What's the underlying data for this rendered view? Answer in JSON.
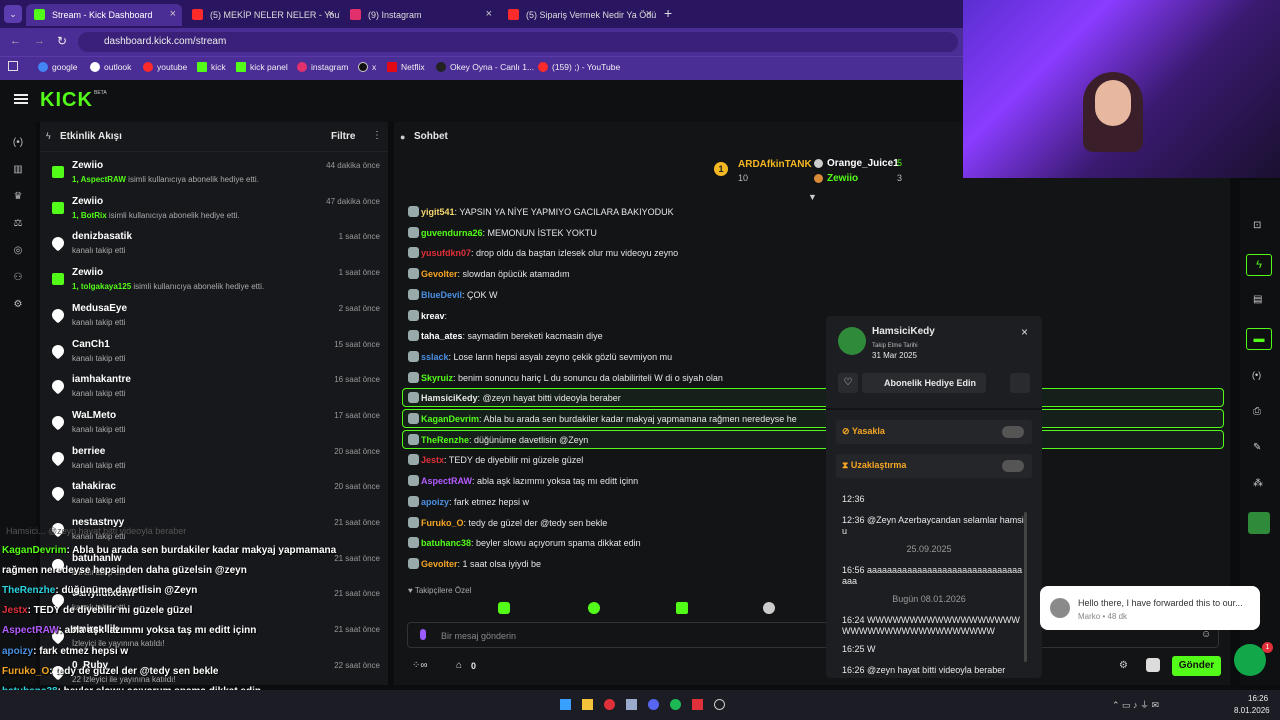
{
  "browser": {
    "tabs": [
      {
        "label": "Stream - Kick Dashboard",
        "color": "#53fc18"
      },
      {
        "label": "(5) MEKİP NELER NELER - YouTu",
        "color": "#ff2a2a"
      },
      {
        "label": "(9) Instagram",
        "color": "#e1306c"
      },
      {
        "label": "(5) Sipariş Vermek Nedir Ya Ödü",
        "color": "#ff2a2a"
      }
    ],
    "url": "dashboard.kick.com/stream",
    "bookmarks": [
      "google",
      "outlook",
      "youtube",
      "kick",
      "kick panel",
      "instagram",
      "x",
      "Netflix",
      "Okey Oyna - Canlı 1...",
      "(159) ;) - YouTube"
    ]
  },
  "kick": {
    "logo": "KICK",
    "beta": "BETA"
  },
  "activity": {
    "title": "Etkinlik Akışı",
    "filter": "Filtre",
    "items": [
      {
        "name": "Zewiio",
        "sub_b": "1, AspectRAW",
        "sub": " isimli kullanıcıya abonelik hediye etti.",
        "time": "44 dakika önce",
        "kind": "gift"
      },
      {
        "name": "Zewiio",
        "sub_b": "1, BotRix",
        "sub": " isimli kullanıcıya abonelik hediye etti.",
        "time": "47 dakika önce",
        "kind": "gift"
      },
      {
        "name": "denizbasatik",
        "sub_b": "",
        "sub": "kanalı takip etti",
        "time": "1 saat önce",
        "kind": "follow"
      },
      {
        "name": "Zewiio",
        "sub_b": "1, tolgakaya125",
        "sub": " isimli kullanıcıya abonelik hediye etti.",
        "time": "1 saat önce",
        "kind": "gift"
      },
      {
        "name": "MedusaEye",
        "sub_b": "",
        "sub": "kanalı takip etti",
        "time": "2 saat önce",
        "kind": "follow"
      },
      {
        "name": "CanCh1",
        "sub_b": "",
        "sub": "kanalı takip etti",
        "time": "15 saat önce",
        "kind": "follow"
      },
      {
        "name": "iamhakantre",
        "sub_b": "",
        "sub": "kanalı takip etti",
        "time": "16 saat önce",
        "kind": "follow"
      },
      {
        "name": "WaLMeto",
        "sub_b": "",
        "sub": "kanalı takip etti",
        "time": "17 saat önce",
        "kind": "follow"
      },
      {
        "name": "berriee",
        "sub_b": "",
        "sub": "kanalı takip etti",
        "time": "20 saat önce",
        "kind": "follow"
      },
      {
        "name": "tahakirac",
        "sub_b": "",
        "sub": "kanalı takip etti",
        "time": "20 saat önce",
        "kind": "follow"
      },
      {
        "name": "nestastnyy",
        "sub_b": "",
        "sub": "kanalı takip etti",
        "time": "21 saat önce",
        "kind": "follow"
      },
      {
        "name": "batuhanlw",
        "sub_b": "",
        "sub": "kanalı takip etti",
        "time": "21 saat önce",
        "kind": "follow"
      },
      {
        "name": "dariyildixonn",
        "sub_b": "",
        "sub": "kanalı takip etti",
        "time": "21 saat önce",
        "kind": "follow"
      },
      {
        "name": "emirsellik",
        "sub_b": "",
        "sub": "İzleyici ile yayınına katıldı!",
        "time": "21 saat önce",
        "kind": "follow"
      },
      {
        "name": "0_Ruby",
        "sub_b": "",
        "sub": "22 İzleyici ile yayınına katıldı!",
        "time": "22 saat önce",
        "kind": "follow"
      }
    ]
  },
  "chat": {
    "title": "Sohbet",
    "top": [
      {
        "name": "ARDAfkinTANK",
        "val": "10"
      },
      {
        "name": "Orange_Juice1",
        "val": "5"
      },
      {
        "name": "Zewiio",
        "val": "3"
      }
    ],
    "messages": [
      {
        "user": "yigit541",
        "color": "#f5d76e",
        "text": ": YAPSIN YA NİYE YAPMIYO GACILARA BAKIYODUK",
        "hl": false
      },
      {
        "user": "guvendurna26",
        "color": "#53fc18",
        "text": ": MEMONUN İSTEK YOKTU",
        "hl": false
      },
      {
        "user": "yusufdkn07",
        "color": "#e0303a",
        "text": ": drop oldu da baştan izlesek olur mu videoyu zeyno",
        "hl": false
      },
      {
        "user": "Gevolter",
        "color": "#f5a623",
        "text": ": slowdan öpücük atamadım",
        "hl": false
      },
      {
        "user": "BlueDevil",
        "color": "#4a90e2",
        "text": ": ÇOK W",
        "hl": false
      },
      {
        "user": "kreav",
        "color": "#ffffff",
        "text": ":",
        "hl": false
      },
      {
        "user": "taha_ates",
        "color": "#ffffff",
        "text": ": saymadim bereketi kacmasin diye",
        "hl": false
      },
      {
        "user": "sslack",
        "color": "#4a90e2",
        "text": ": Lose ların hepsi asyalı zeyno çekik gözlü sevmiyon mu",
        "hl": false
      },
      {
        "user": "Skyruiz",
        "color": "#53fc18",
        "text": ": benim sonuncu hariç L du sonuncu da olabiliriteli W di o siyah olan",
        "hl": false
      },
      {
        "user": "HamsiciKedy",
        "color": "#e6e6e6",
        "text": ": @zeyn hayat bitti videoyla beraber",
        "hl": true
      },
      {
        "user": "KaganDevrim",
        "color": "#53fc18",
        "text": ": Abla bu arada sen burdakiler kadar makyaj yapmamana rağmen neredeyse he",
        "hl": true
      },
      {
        "user": "TheRenzhe",
        "color": "#53fc18",
        "text": ": düğünüme davetlisin @Zeyn",
        "hl": true
      },
      {
        "user": "Jestx",
        "color": "#e0303a",
        "text": ": TEDY de diyebilir mi güzele güzel",
        "hl": false
      },
      {
        "user": "AspectRAW",
        "color": "#b45cff",
        "text": ": abla aşk lazımmı yoksa taş mı editt içinn",
        "hl": false
      },
      {
        "user": "apoizy",
        "color": "#4a90e2",
        "text": ": fark etmez hepsi w",
        "hl": false
      },
      {
        "user": "Furuko_O",
        "color": "#f5a623",
        "text": ": tedy de güzel der @tedy sen bekle",
        "hl": false
      },
      {
        "user": "batuhanc38",
        "color": "#53fc18",
        "text": ": beyler slowu açıyorum spama dikkat edin",
        "hl": false
      },
      {
        "user": "Gevolter",
        "color": "#f5a623",
        "text": ": 1 saat olsa iyiydi be",
        "hl": false
      }
    ],
    "followers_only": "Takipçilere Özel",
    "input_placeholder": "Bir mesaj gönderin",
    "points": "0",
    "send": "Gönder"
  },
  "popup": {
    "user": "HamsiciKedy",
    "follow_label": "Takip Etme Tarihi",
    "follow_date": "31 Mar 2025",
    "gift": "Abonelik Hediye Edin",
    "ban": "Yasakla",
    "timeout": "Uzaklaştırma",
    "history": [
      {
        "kind": "msg",
        "text": "12:36"
      },
      {
        "kind": "msg",
        "text": "12:36 @Zeyn Azerbaycandan selamlar hamsiu"
      },
      {
        "kind": "date",
        "text": "25.09.2025"
      },
      {
        "kind": "msg",
        "text": "16:56 aaaaaaaaaaaaaaaaaaaaaaaaaaaaaaaaaa"
      },
      {
        "kind": "date",
        "text": "Bugün 08.01.2026"
      },
      {
        "kind": "msg",
        "text": "16:24 WWWWWWWWWWWWWWWWWWWWWWWWWWWWWWWWWWWW"
      },
      {
        "kind": "msg",
        "text": "16:25 W"
      },
      {
        "kind": "msg",
        "text": "16:26 @zeyn hayat bitti videoyla beraber"
      }
    ]
  },
  "overlay": [
    {
      "user": "KaganDevrim",
      "color": "#53fc18",
      "text": ": Abla bu arada sen burdakiler kadar makyaj yapmamana"
    },
    {
      "user": "",
      "color": "#fff",
      "text": "rağmen neredeyse hepsinden daha güzelsin @zeyn"
    },
    {
      "user": "TheRenzhe",
      "color": "#2bd4e0",
      "text": ": düğünüme davetlisin @Zeyn"
    },
    {
      "user": "Jestx",
      "color": "#e0303a",
      "text": ": TEDY de diyebilir mi güzele güzel"
    },
    {
      "user": "AspectRAW",
      "color": "#b45cff",
      "text": ": abla aşk lazımmı yoksa taş mı editt içinn"
    },
    {
      "user": "apoizy",
      "color": "#4a90e2",
      "text": ": fark etmez hepsi w"
    },
    {
      "user": "Furuko_O",
      "color": "#f5a623",
      "text": ": tedy de güzel der @tedy sen bekle"
    },
    {
      "user": "batuhanc38",
      "color": "#2bd4e0",
      "text": ": beyler slowu açıyorum spama dikkat edin"
    },
    {
      "user": "Gevolter",
      "color": "#f5a623",
      "text": ": 1 saat olsa iyiydi be"
    }
  ],
  "ghost": "Hamsici... @zeyn hayat bitti videoyla beraber",
  "toast": {
    "text": "Hello there, I have forwarded this to our...",
    "meta": "Marko • 48 dk",
    "count": "1"
  },
  "taskbar": {
    "time": "16:26",
    "date": "8.01.2026"
  }
}
